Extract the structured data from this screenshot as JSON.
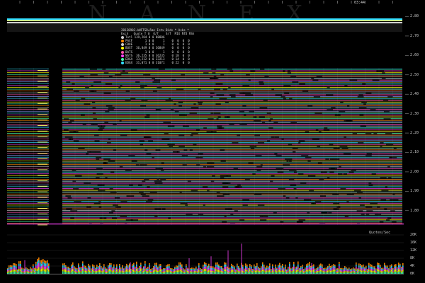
{
  "watermark": "NANEX",
  "time_label": "03:44",
  "chart_data": [
    {
      "type": "line",
      "title": "",
      "yticks": [
        "2.80",
        "2.70",
        "2.60",
        "2.50",
        "2.40",
        "2.30",
        "2.20",
        "2.10",
        "2.00",
        "1.90",
        "1.80"
      ],
      "ylim": [
        1.77,
        2.82
      ],
      "legend": {
        "header1": "20130903.kWFTSD=5ms Intv Bids * Asks *",
        "header2": "Exch   Quote T 0  O/T    S/T  MIX NTD RSh",
        "rows": [
          {
            "label": "Totl 139,284 0 0 88806",
            "color": "#cfcfcf"
          },
          {
            "label": "PACF       1 0 0     1    0  0  0  0",
            "color": "#ff8800"
          },
          {
            "label": "CBOE       1 0 0     1    0  0  0  0",
            "color": "#d0d0d0"
          },
          {
            "label": "BOST  36,849 0 0 36849    0  0  0  0",
            "color": "#ffff00"
          },
          {
            "label": "BATS       1 0 0     1    0  0  0  0",
            "color": "#ff55aa"
          },
          {
            "label": "NSTS  36,235 0 0 36235    0 18  0  0",
            "color": "#ff44ff"
          },
          {
            "label": "EDGA  33,212 0 0 33213    0 14  0  0",
            "color": "#44ffaa"
          },
          {
            "label": "EDGX  31,071 0 0 31071    0 22  0  0",
            "color": "#33ddff"
          }
        ]
      }
    },
    {
      "type": "bar",
      "title": "Quotes/Sec",
      "yticks": [
        "20K",
        "16K",
        "12K",
        "8K",
        "4K",
        "0K"
      ],
      "ylim": [
        0,
        20000
      ]
    }
  ]
}
